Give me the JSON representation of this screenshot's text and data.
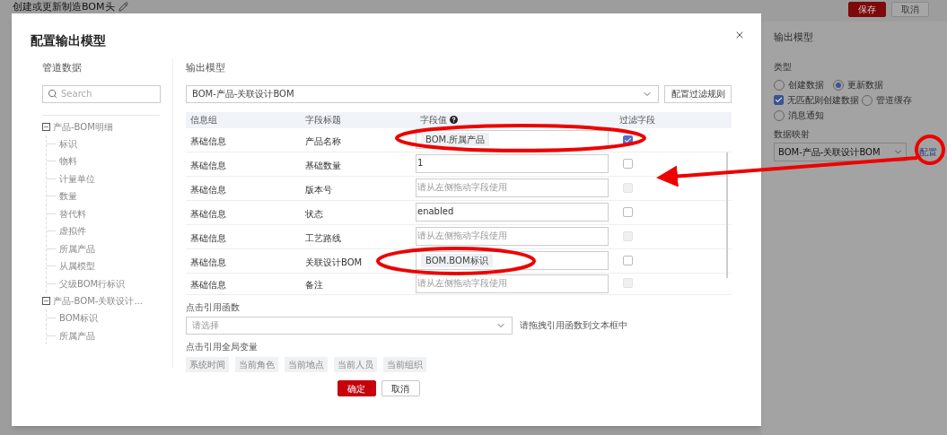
{
  "page": {
    "title": "创建或更新制造BOM头",
    "buttons": [
      {
        "label": "保存",
        "kind": "primary"
      },
      {
        "label": "取消",
        "kind": "default"
      }
    ]
  },
  "side_panel": {
    "title": "输出模型",
    "type_label": "类型",
    "options": [
      {
        "kind": "radio",
        "label": "创建数据",
        "selected": false
      },
      {
        "kind": "radio",
        "label": "更新数据",
        "selected": true
      },
      {
        "kind": "checkbox",
        "label": "无匹配则创建数据",
        "checked": true
      },
      {
        "kind": "radio",
        "label": "管道缓存",
        "selected": false
      },
      {
        "kind": "radio",
        "label": "消息通知",
        "selected": false
      }
    ],
    "mapping_label": "数据映射",
    "mapping_value": "BOM-产品-关联设计BOM",
    "config_link": "配置"
  },
  "dialog": {
    "title": "配置输出模型",
    "pipeline": {
      "heading": "管道数据",
      "search": {
        "placeholder": "Search"
      },
      "tree": [
        {
          "label": "产品-BOM明细",
          "expanded": true,
          "children": [
            {
              "label": "标识"
            },
            {
              "label": "物料"
            },
            {
              "label": "计量单位"
            },
            {
              "label": "数量"
            },
            {
              "label": "替代料"
            },
            {
              "label": "虚拟件"
            },
            {
              "label": "所属产品"
            },
            {
              "label": "从属模型"
            },
            {
              "label": "父级BOM行标识"
            }
          ]
        },
        {
          "label": "产品-BOM-关联设计...",
          "expanded": true,
          "children": [
            {
              "label": "BOM标识"
            },
            {
              "label": "所属产品"
            }
          ]
        }
      ]
    },
    "output": {
      "heading": "输出模型",
      "model_select": "BOM-产品-关联设计BOM",
      "filter_button": "配置过滤规则",
      "columns": [
        "信息组",
        "字段标题",
        "字段值",
        "过滤字段"
      ],
      "rows": [
        {
          "group": "基础信息",
          "field": "产品名称",
          "value": {
            "kind": "chip",
            "text": "BOM.所属产品"
          },
          "filter": {
            "checked": true,
            "disabled": false
          }
        },
        {
          "group": "基础信息",
          "field": "基础数量",
          "value": {
            "kind": "text",
            "text": "1"
          },
          "filter": {
            "checked": false,
            "disabled": false
          }
        },
        {
          "group": "基础信息",
          "field": "版本号",
          "value": {
            "kind": "empty",
            "placeholder": "请从左侧拖动字段使用"
          },
          "filter": {
            "checked": false,
            "disabled": true
          }
        },
        {
          "group": "基础信息",
          "field": "状态",
          "value": {
            "kind": "text",
            "text": "enabled"
          },
          "filter": {
            "checked": false,
            "disabled": false
          }
        },
        {
          "group": "基础信息",
          "field": "工艺路线",
          "value": {
            "kind": "empty",
            "placeholder": "请从左侧拖动字段使用"
          },
          "filter": {
            "checked": false,
            "disabled": true
          }
        },
        {
          "group": "基础信息",
          "field": "关联设计BOM",
          "value": {
            "kind": "chip",
            "text": "BOM.BOM标识"
          },
          "filter": {
            "checked": false,
            "disabled": false
          }
        },
        {
          "group": "基础信息",
          "field": "备注",
          "value": {
            "kind": "empty",
            "placeholder": "请从左侧拖动字段使用"
          },
          "filter": {
            "checked": false,
            "disabled": true
          }
        }
      ],
      "function_label": "点击引用函数",
      "function_select": {
        "placeholder": "请选择"
      },
      "function_hint": "请拖拽引用函数到文本框中",
      "variables_label": "点击引用全局变量",
      "variables": [
        "系统时间",
        "当前角色",
        "当前地点",
        "当前人员",
        "当前组织"
      ]
    },
    "buttons": [
      {
        "label": "确定",
        "kind": "primary"
      },
      {
        "label": "取消",
        "kind": "default"
      }
    ]
  }
}
